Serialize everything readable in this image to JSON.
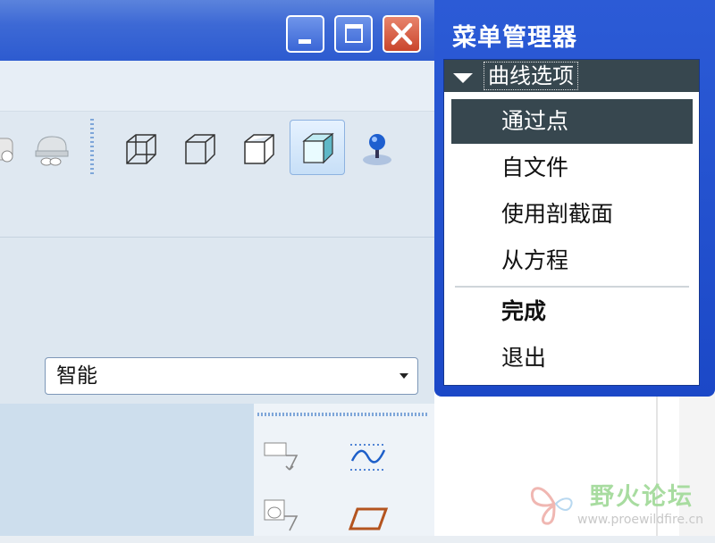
{
  "window": {
    "controls": {
      "minimize": "minimize-icon",
      "maximize": "maximize-icon",
      "close": "close-icon"
    }
  },
  "toolbar": {
    "icons": [
      "layer-icon",
      "model-tree-icon",
      "view-iso-icon",
      "view-front-icon",
      "view-side-icon",
      "view-shaded-icon",
      "appearance-ball-icon"
    ]
  },
  "filter": {
    "selected": "智能"
  },
  "menu_manager": {
    "title": "菜单管理器",
    "section_label": "曲线选项",
    "items": [
      {
        "label": "通过点",
        "selected": true
      },
      {
        "label": "自文件"
      },
      {
        "label": "使用剖截面"
      },
      {
        "label": "从方程"
      },
      {
        "label": "完成",
        "bold": true
      },
      {
        "label": "退出"
      }
    ]
  },
  "watermark": {
    "title": "野火论坛",
    "url": "www.proewildfire.cn"
  },
  "colors": {
    "title_bar": "#2d5bd0",
    "menu_header": "#37474f",
    "close_button": "#c9452c"
  }
}
